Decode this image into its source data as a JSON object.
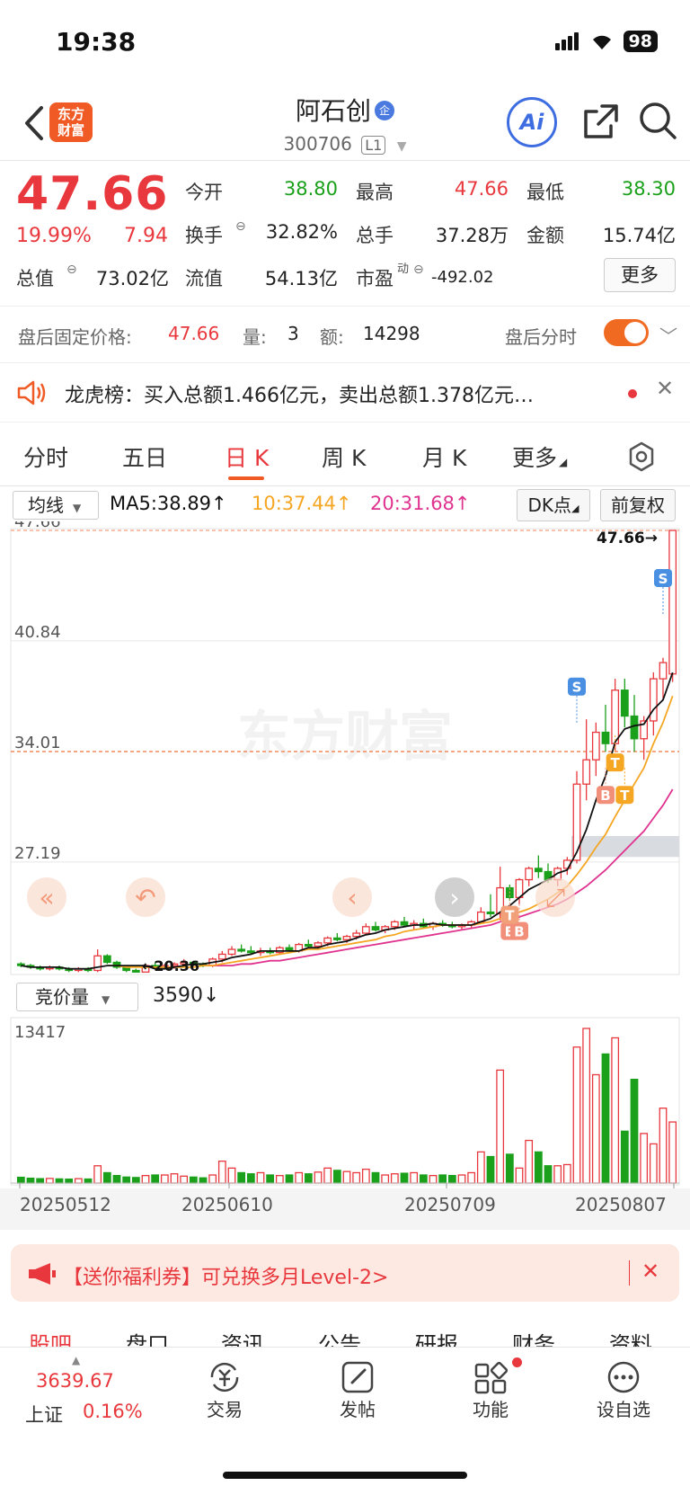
{
  "status": {
    "time": "19:38",
    "battery": "98"
  },
  "header": {
    "logo": "东方财富",
    "name": "阿石创",
    "badge": "企",
    "code": "300706",
    "level": "L1",
    "ai": "Ai"
  },
  "quote": {
    "price": "47.66",
    "pct": "19.99%",
    "chg": "7.94",
    "open_label": "今开",
    "open": "38.80",
    "high_label": "最高",
    "high": "47.66",
    "low_label": "最低",
    "low": "38.30",
    "turnover_label": "换手",
    "turnover": "32.82%",
    "volume_label": "总手",
    "volume": "37.28万",
    "amount_label": "金额",
    "amount": "15.74亿",
    "mcap_label": "总值",
    "mcap": "73.02亿",
    "float_label": "流值",
    "float": "54.13亿",
    "pe_label": "市盈",
    "pe_sup": "动",
    "pe": "-492.02",
    "more": "更多"
  },
  "afterhours": {
    "label": "盘后固定价格:",
    "price": "47.66",
    "vol_label": "量:",
    "vol": "3",
    "amt_label": "额:",
    "amt": "14298",
    "toggle_label": "盘后分时"
  },
  "dragon": {
    "text": "龙虎榜：买入总额1.466亿元，卖出总额1.378亿元…"
  },
  "tabs": [
    "分时",
    "五日",
    "日 K",
    "周 K",
    "月 K",
    "更多"
  ],
  "chart_header": {
    "ma_select": "均线",
    "ma5": "MA5:38.89↑",
    "ma10": "10:37.44↑",
    "ma20": "20:31.68↑",
    "dk": "DK点",
    "fq": "前复权",
    "vol_select": "竞价量",
    "vol_value": "3590↓",
    "watermark": "东方财富"
  },
  "promo": {
    "text": "【送你福利券】可兑换多月Level-2>"
  },
  "subtabs": [
    "股吧",
    "盘口",
    "资讯",
    "公告",
    "研报",
    "财务",
    "资料"
  ],
  "bottom_nav": {
    "index_value": "3639.67",
    "index_name": "上证",
    "index_pct": "0.16%",
    "items": [
      "交易",
      "发帖",
      "功能",
      "设自选"
    ]
  },
  "colors": {
    "up": "#e8383d",
    "down": "#1aa01a",
    "ma5": "#111111",
    "ma10": "#f5a623",
    "ma20": "#e0338f",
    "accent": "#f05a24"
  },
  "chart_data": {
    "type": "candlestick",
    "y_ticks": [
      "47.66",
      "40.84",
      "34.01",
      "27.19"
    ],
    "min_label": "20.36",
    "last_label": "47.66",
    "ylim": [
      20.36,
      47.66
    ],
    "x_labels": [
      "20250512",
      "20250610",
      "20250709",
      "20250807"
    ],
    "vol_max_label": "13417",
    "candles": [
      [
        20.9,
        21.0,
        20.7,
        20.8
      ],
      [
        20.8,
        20.9,
        20.6,
        20.7
      ],
      [
        20.7,
        20.8,
        20.5,
        20.6
      ],
      [
        20.6,
        20.8,
        20.5,
        20.7
      ],
      [
        20.7,
        20.8,
        20.5,
        20.6
      ],
      [
        20.6,
        20.7,
        20.4,
        20.5
      ],
      [
        20.5,
        20.7,
        20.4,
        20.6
      ],
      [
        20.6,
        20.7,
        20.4,
        20.5
      ],
      [
        20.5,
        21.8,
        20.4,
        21.4
      ],
      [
        21.4,
        21.5,
        20.9,
        21.0
      ],
      [
        21.0,
        21.1,
        20.6,
        20.7
      ],
      [
        20.7,
        20.8,
        20.4,
        20.5
      ],
      [
        20.5,
        20.6,
        20.36,
        20.4
      ],
      [
        20.4,
        20.9,
        20.4,
        20.8
      ],
      [
        20.8,
        21.0,
        20.6,
        20.7
      ],
      [
        20.7,
        20.9,
        20.6,
        20.8
      ],
      [
        20.8,
        21.0,
        20.6,
        20.9
      ],
      [
        20.9,
        21.2,
        20.8,
        21.0
      ],
      [
        21.0,
        21.1,
        20.8,
        20.9
      ],
      [
        20.9,
        21.0,
        20.7,
        20.8
      ],
      [
        20.8,
        21.3,
        20.7,
        21.2
      ],
      [
        21.2,
        21.7,
        21.0,
        21.5
      ],
      [
        21.5,
        22.0,
        21.4,
        21.8
      ],
      [
        21.8,
        22.1,
        21.6,
        21.7
      ],
      [
        21.7,
        22.0,
        21.5,
        21.6
      ],
      [
        21.6,
        21.9,
        21.4,
        21.7
      ],
      [
        21.7,
        21.9,
        21.5,
        21.6
      ],
      [
        21.6,
        22.0,
        21.5,
        21.9
      ],
      [
        21.9,
        22.1,
        21.6,
        21.7
      ],
      [
        21.7,
        22.2,
        21.6,
        22.1
      ],
      [
        22.1,
        22.4,
        21.9,
        22.0
      ],
      [
        22.0,
        22.3,
        21.8,
        22.2
      ],
      [
        22.2,
        22.6,
        22.0,
        22.5
      ],
      [
        22.5,
        22.8,
        22.3,
        22.4
      ],
      [
        22.4,
        22.7,
        22.2,
        22.6
      ],
      [
        22.6,
        23.0,
        22.4,
        22.8
      ],
      [
        22.8,
        23.4,
        22.7,
        23.2
      ],
      [
        23.2,
        23.5,
        22.9,
        23.0
      ],
      [
        23.0,
        23.3,
        22.8,
        23.2
      ],
      [
        23.2,
        23.6,
        23.0,
        23.5
      ],
      [
        23.5,
        23.8,
        23.2,
        23.3
      ],
      [
        23.3,
        23.6,
        23.0,
        23.4
      ],
      [
        23.4,
        23.7,
        23.1,
        23.2
      ],
      [
        23.2,
        23.5,
        23.0,
        23.4
      ],
      [
        23.4,
        23.6,
        23.2,
        23.3
      ],
      [
        23.3,
        23.5,
        23.1,
        23.2
      ],
      [
        23.2,
        23.4,
        23.0,
        23.3
      ],
      [
        23.3,
        23.6,
        23.1,
        23.5
      ],
      [
        23.5,
        24.4,
        23.4,
        24.1
      ],
      [
        24.1,
        25.2,
        23.8,
        24.0
      ],
      [
        24.0,
        26.9,
        23.6,
        25.6
      ],
      [
        25.6,
        25.8,
        24.8,
        25.0
      ],
      [
        25.0,
        26.2,
        24.6,
        26.1
      ],
      [
        26.1,
        26.9,
        25.7,
        26.8
      ],
      [
        26.8,
        27.6,
        26.2,
        26.6
      ],
      [
        26.6,
        27.1,
        25.9,
        26.1
      ],
      [
        26.1,
        26.9,
        25.7,
        26.8
      ],
      [
        26.8,
        27.5,
        26.4,
        27.3
      ],
      [
        27.3,
        32.8,
        27.1,
        32.0
      ],
      [
        32.0,
        36.0,
        31.0,
        33.5
      ],
      [
        33.5,
        35.8,
        32.5,
        35.2
      ],
      [
        35.2,
        36.9,
        34.0,
        34.5
      ],
      [
        34.5,
        38.5,
        34.0,
        37.8
      ],
      [
        37.8,
        38.5,
        35.5,
        36.2
      ],
      [
        36.2,
        37.5,
        34.0,
        34.8
      ],
      [
        34.8,
        36.2,
        33.5,
        35.9
      ],
      [
        35.9,
        38.9,
        35.0,
        38.5
      ],
      [
        38.5,
        39.8,
        37.2,
        39.5
      ],
      [
        38.8,
        47.66,
        38.3,
        47.66
      ]
    ],
    "ma5": [
      20.8,
      20.7,
      20.7,
      20.7,
      20.7,
      20.6,
      20.6,
      20.6,
      20.7,
      20.8,
      20.8,
      20.8,
      20.8,
      20.8,
      20.6,
      20.6,
      20.7,
      20.8,
      20.9,
      20.9,
      21.0,
      21.1,
      21.3,
      21.4,
      21.5,
      21.7,
      21.7,
      21.7,
      21.7,
      21.7,
      21.9,
      21.9,
      22.1,
      22.2,
      22.3,
      22.5,
      22.7,
      22.8,
      23.0,
      23.1,
      23.2,
      23.3,
      23.3,
      23.4,
      23.3,
      23.3,
      23.3,
      23.3,
      23.5,
      23.7,
      24.1,
      24.5,
      25.0,
      25.5,
      25.8,
      26.1,
      26.5,
      26.7,
      27.8,
      29.2,
      31.0,
      32.5,
      34.6,
      35.4,
      35.6,
      35.7,
      36.6,
      37.2,
      38.89
    ],
    "ma10": [
      null,
      null,
      null,
      null,
      null,
      null,
      null,
      null,
      null,
      20.8,
      20.8,
      20.7,
      20.7,
      20.7,
      20.7,
      20.7,
      20.7,
      20.7,
      20.7,
      20.8,
      20.8,
      20.9,
      21.0,
      21.1,
      21.2,
      21.3,
      21.4,
      21.5,
      21.6,
      21.7,
      21.8,
      21.8,
      21.9,
      22.0,
      22.1,
      22.2,
      22.3,
      22.4,
      22.6,
      22.7,
      22.9,
      23.0,
      23.1,
      23.2,
      23.3,
      23.3,
      23.3,
      23.3,
      23.4,
      23.5,
      23.7,
      23.9,
      24.1,
      24.3,
      24.6,
      24.9,
      25.3,
      25.7,
      26.4,
      27.2,
      28.1,
      28.9,
      30.0,
      31.0,
      32.0,
      33.0,
      34.5,
      35.8,
      37.44
    ],
    "ma20": [
      null,
      null,
      null,
      null,
      null,
      null,
      null,
      null,
      null,
      null,
      null,
      null,
      null,
      null,
      null,
      null,
      null,
      null,
      null,
      20.8,
      20.8,
      20.8,
      20.8,
      20.9,
      20.9,
      21.0,
      21.1,
      21.1,
      21.2,
      21.3,
      21.4,
      21.5,
      21.6,
      21.7,
      21.8,
      21.9,
      22.0,
      22.1,
      22.2,
      22.3,
      22.4,
      22.5,
      22.6,
      22.7,
      22.8,
      22.9,
      23.0,
      23.1,
      23.2,
      23.3,
      23.5,
      23.6,
      23.8,
      24.0,
      24.2,
      24.4,
      24.6,
      24.9,
      25.3,
      25.7,
      26.2,
      26.7,
      27.3,
      27.9,
      28.5,
      29.1,
      29.9,
      30.7,
      31.68
    ],
    "volumes": [
      500,
      420,
      380,
      400,
      360,
      340,
      380,
      350,
      1500,
      900,
      650,
      520,
      480,
      650,
      700,
      700,
      800,
      600,
      520,
      450,
      700,
      1900,
      1300,
      900,
      800,
      900,
      700,
      650,
      700,
      900,
      800,
      950,
      1300,
      1100,
      1000,
      900,
      1200,
      900,
      700,
      800,
      850,
      900,
      700,
      650,
      700,
      650,
      700,
      900,
      2700,
      2300,
      9800,
      2500,
      1300,
      3700,
      2700,
      1500,
      1500,
      1600,
      11800,
      13417,
      9400,
      11200,
      12600,
      4500,
      9000,
      4300,
      3400,
      6500,
      5300
    ]
  }
}
